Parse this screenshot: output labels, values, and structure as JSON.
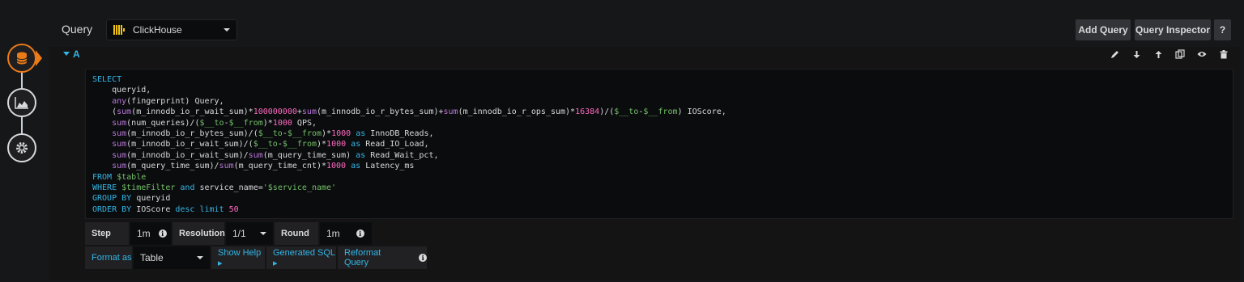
{
  "query_section": {
    "title": "Query",
    "datasource": "ClickHouse",
    "add_query_label": "Add Query",
    "query_inspector_label": "Query Inspector",
    "help_label": "?"
  },
  "query_row": {
    "label": "A",
    "tools": [
      "pencil-icon",
      "arrow-down-icon",
      "arrow-up-icon",
      "duplicate-icon",
      "eye-icon",
      "trash-icon"
    ]
  },
  "sql_lines": [
    "SELECT",
    "    queryid,",
    "    any(fingerprint) Query,",
    "    (sum(m_innodb_io_r_wait_sum)*100000000+sum(m_innodb_io_r_bytes_sum)+sum(m_innodb_io_r_ops_sum)*16384)/($__to-$__from) IOScore,",
    "    sum(num_queries)/($__to-$__from)*1000 QPS,",
    "    sum(m_innodb_io_r_bytes_sum)/($__to-$__from)*1000 as InnoDB_Reads,",
    "    sum(m_innodb_io_r_wait_sum)/($__to-$__from)*1000 as Read_IO_Load,",
    "    sum(m_innodb_io_r_wait_sum)/sum(m_query_time_sum) as Read_Wait_pct,",
    "    sum(m_query_time_sum)/sum(m_query_time_cnt)*1000 as Latency_ms",
    "FROM $table",
    "WHERE $timeFilter and service_name='$service_name'",
    "GROUP BY queryid",
    "ORDER BY IOScore desc limit 50"
  ],
  "options": {
    "step_label": "Step",
    "step_value": "1m",
    "resolution_label": "Resolution",
    "resolution_value": "1/1",
    "round_label": "Round",
    "round_value": "1m"
  },
  "format_row": {
    "format_as_label": "Format as",
    "format_as_value": "Table",
    "show_help_label": "Show Help ▸",
    "generated_sql_label": "Generated SQL ▸",
    "reformat_query_label": "Reformat Query"
  },
  "colors": {
    "accent": "#33b5e5",
    "active_step": "#eb7b18",
    "datasource_logo": "#f2c511"
  }
}
